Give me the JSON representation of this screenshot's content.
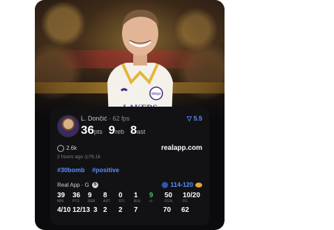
{
  "post": {
    "player_name": "L. Dončić",
    "fps": "· 62 fps",
    "rating": "5.5",
    "stats": [
      {
        "value": "36",
        "unit": "pts"
      },
      {
        "value": "9",
        "unit": "reb"
      },
      {
        "value": "8",
        "unit": "ast"
      }
    ],
    "likes": "2.6k",
    "site": "realapp.com",
    "time_ago": "2 hours ago",
    "views": "76.1k",
    "tags": [
      "#30bomb",
      "#positive"
    ]
  },
  "game": {
    "source": "Real App · G",
    "badge": "S",
    "score": "114-120",
    "box": [
      {
        "value": "39",
        "label": "MIN"
      },
      {
        "value": "36",
        "label": "PTS"
      },
      {
        "value": "9",
        "label": "REB"
      },
      {
        "value": "8",
        "label": "AST"
      },
      {
        "value": "0",
        "label": "STL"
      },
      {
        "value": "1",
        "label": "BLK"
      },
      {
        "value": "9",
        "label": "+/-",
        "green": true
      },
      {
        "value": "50",
        "label": "FG%"
      },
      {
        "value": "10/20",
        "label": "FG"
      }
    ],
    "box2": [
      "4/10",
      "12/13",
      "3",
      "2",
      "2",
      "7",
      "",
      "70",
      "62"
    ]
  },
  "colors": {
    "accent": "#5b8cff",
    "positive": "#3bc46a",
    "card_bg": "#0b0b0d",
    "panel_bg": "#121214"
  }
}
